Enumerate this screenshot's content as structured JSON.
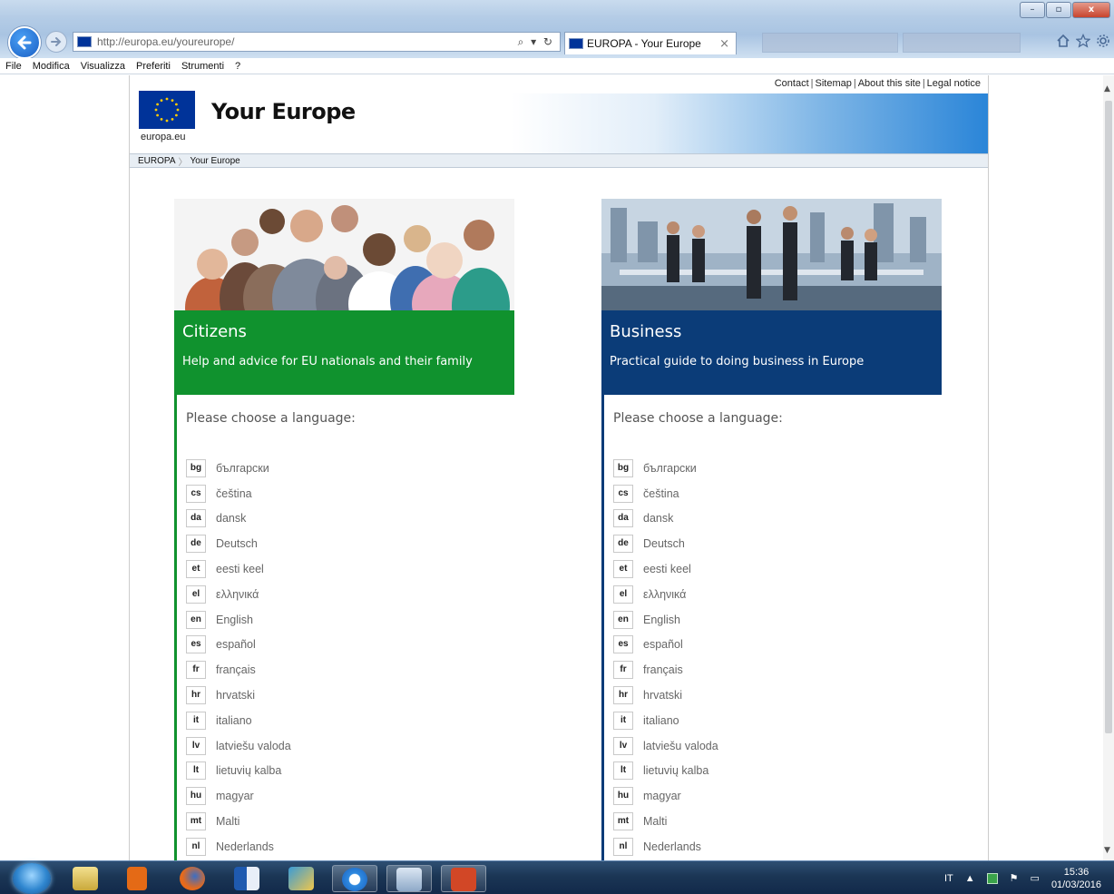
{
  "browser": {
    "url": "http://europa.eu/youreurope/",
    "tab_title": "EUROPA - Your Europe",
    "tab_close": "×",
    "address_tools": "⌕ ▾ ↻",
    "menu": [
      "File",
      "Modifica",
      "Visualizza",
      "Preferiti",
      "Strumenti",
      "?"
    ],
    "window_controls": {
      "minimize": "–",
      "maximize": "▫",
      "close": "x"
    },
    "right_icons": [
      "home-icon",
      "star-icon",
      "gear-icon"
    ]
  },
  "site": {
    "logo_label": "europa.eu",
    "title": "Your Europe",
    "top_links": [
      "Contact",
      "Sitemap",
      "About this site",
      "Legal notice"
    ],
    "breadcrumb": [
      "EUROPA",
      "Your Europe"
    ]
  },
  "panels": [
    {
      "id": "citizens",
      "title": "Citizens",
      "subtitle": "Help and advice for EU nationals and their family",
      "color": "#10922e",
      "choose_label": "Please choose a language:",
      "languages": [
        {
          "code": "bg",
          "name": "български"
        },
        {
          "code": "cs",
          "name": "čeština"
        },
        {
          "code": "da",
          "name": "dansk"
        },
        {
          "code": "de",
          "name": "Deutsch"
        },
        {
          "code": "et",
          "name": "eesti keel"
        },
        {
          "code": "el",
          "name": "ελληνικά"
        },
        {
          "code": "en",
          "name": "English"
        },
        {
          "code": "es",
          "name": "español"
        },
        {
          "code": "fr",
          "name": "français"
        },
        {
          "code": "hr",
          "name": "hrvatski"
        },
        {
          "code": "it",
          "name": "italiano"
        },
        {
          "code": "lv",
          "name": "latviešu valoda"
        },
        {
          "code": "lt",
          "name": "lietuvių kalba"
        },
        {
          "code": "hu",
          "name": "magyar"
        },
        {
          "code": "mt",
          "name": "Malti"
        },
        {
          "code": "nl",
          "name": "Nederlands"
        }
      ]
    },
    {
      "id": "business",
      "title": "Business",
      "subtitle": "Practical guide to doing business in Europe",
      "color": "#0b3c78",
      "choose_label": "Please choose a language:",
      "languages": [
        {
          "code": "bg",
          "name": "български"
        },
        {
          "code": "cs",
          "name": "čeština"
        },
        {
          "code": "da",
          "name": "dansk"
        },
        {
          "code": "de",
          "name": "Deutsch"
        },
        {
          "code": "et",
          "name": "eesti keel"
        },
        {
          "code": "el",
          "name": "ελληνικά"
        },
        {
          "code": "en",
          "name": "English"
        },
        {
          "code": "es",
          "name": "español"
        },
        {
          "code": "fr",
          "name": "français"
        },
        {
          "code": "hr",
          "name": "hrvatski"
        },
        {
          "code": "it",
          "name": "italiano"
        },
        {
          "code": "lv",
          "name": "latviešu valoda"
        },
        {
          "code": "lt",
          "name": "lietuvių kalba"
        },
        {
          "code": "hu",
          "name": "magyar"
        },
        {
          "code": "mt",
          "name": "Malti"
        },
        {
          "code": "nl",
          "name": "Nederlands"
        }
      ]
    }
  ],
  "taskbar": {
    "apps": [
      "file-explorer-icon",
      "media-player-icon",
      "firefox-icon",
      "outlook-icon",
      "folder-icon",
      "internet-explorer-icon",
      "window-icon",
      "powerpoint-icon"
    ],
    "tray_language": "IT",
    "time": "15:36",
    "date": "01/03/2016"
  }
}
